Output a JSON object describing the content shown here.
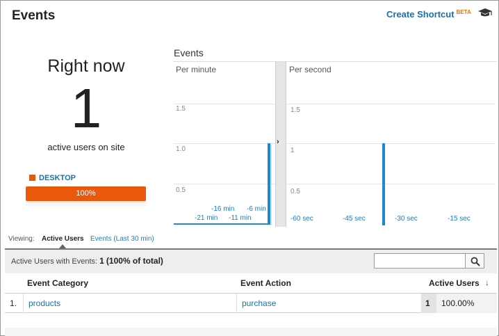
{
  "header": {
    "title": "Events",
    "shortcut_label": "Create Shortcut",
    "shortcut_badge": "BETA",
    "help_icon": "graduation-cap-icon"
  },
  "right_now": {
    "title": "Right now",
    "count": "1",
    "subtitle": "active users on site",
    "device_label": "DESKTOP",
    "device_percent_label": "100%",
    "device_percent": 100,
    "device_color": "#e8590c"
  },
  "events_chart": {
    "title": "Events",
    "per_minute": {
      "label": "Per minute",
      "y_ticks": [
        "1.5",
        "1.0",
        "0.5"
      ],
      "x_ticks_top": [
        "-16 min",
        "-6 min"
      ],
      "x_ticks_bottom": [
        "-21 min",
        "-11 min"
      ]
    },
    "per_second": {
      "label": "Per second",
      "y_ticks": [
        "1.5",
        "1",
        "0.5"
      ],
      "x_ticks": [
        "-60 sec",
        "-45 sec",
        "-30 sec",
        "-15 sec"
      ]
    },
    "expand_icon": "chevron-right-icon",
    "bar_color": "#1e88d0"
  },
  "chart_data": [
    {
      "type": "bar",
      "title": "Per minute",
      "ylim": [
        0,
        2
      ],
      "series": [
        {
          "values": [
            1
          ]
        }
      ],
      "note_position": "most recent minute"
    },
    {
      "type": "bar",
      "title": "Per second",
      "ylim": [
        0,
        2
      ],
      "series": [
        {
          "values": [
            1
          ]
        }
      ],
      "note_position": "about -31 sec"
    }
  ],
  "viewing": {
    "label": "Viewing:",
    "active_tab": "Active Users",
    "other_tab": "Events (Last 30 min)"
  },
  "table": {
    "summary_label": "Active Users with Events:",
    "summary_value": "1",
    "summary_pct": "(100% of total)",
    "search_placeholder": "",
    "columns": [
      "Event Category",
      "Event Action",
      "Active Users"
    ],
    "rows": [
      {
        "index": "1.",
        "category": "products",
        "action": "purchase",
        "users": "1",
        "pct": "100.00%"
      }
    ]
  }
}
